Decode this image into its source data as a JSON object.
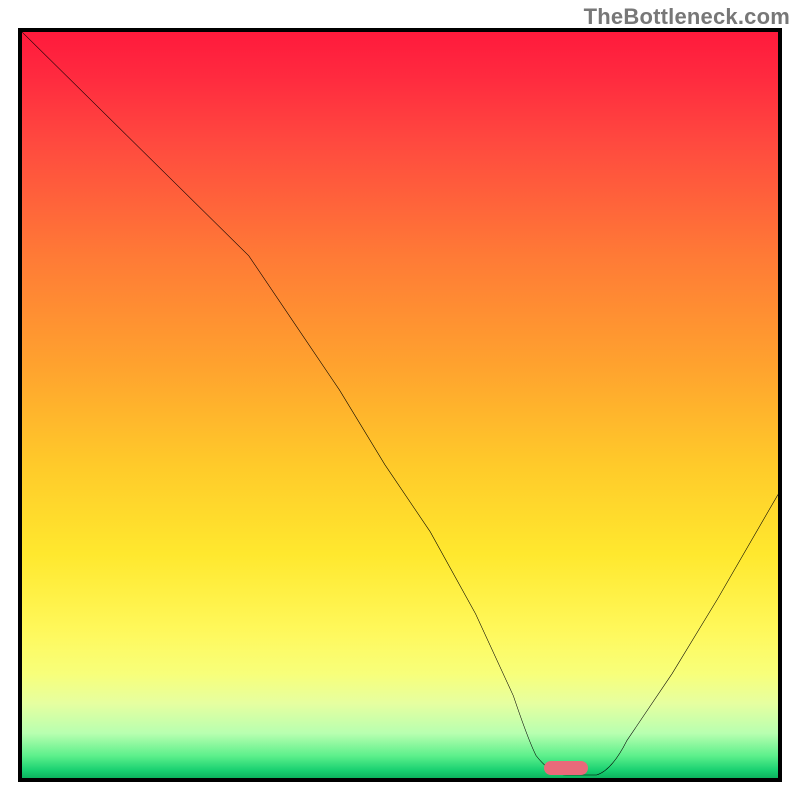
{
  "watermark_text": "TheBottleneck.com",
  "chart_data": {
    "type": "line",
    "title": "",
    "xlabel": "",
    "ylabel": "",
    "xlim": [
      0,
      100
    ],
    "ylim": [
      0,
      100
    ],
    "grid": false,
    "legend": false,
    "annotations": [
      {
        "type": "marker",
        "x": 72,
        "y": 0.5,
        "shape": "rounded-bar",
        "color": "#e96a7a"
      }
    ],
    "background_gradient": {
      "direction": "vertical",
      "stops": [
        {
          "pos": 0,
          "color": "#ff1a3c",
          "label": "red"
        },
        {
          "pos": 50,
          "color": "#ffb030",
          "label": "orange"
        },
        {
          "pos": 80,
          "color": "#fff060",
          "label": "yellow"
        },
        {
          "pos": 100,
          "color": "#10c060",
          "label": "green"
        }
      ]
    },
    "series": [
      {
        "name": "bottleneck-curve",
        "color": "#000000",
        "x": [
          0,
          7,
          14,
          20,
          26,
          30,
          36,
          42,
          48,
          54,
          60,
          65,
          68,
          72,
          76,
          80,
          86,
          92,
          100
        ],
        "y": [
          100,
          93,
          86,
          80,
          74,
          70,
          61,
          52,
          42,
          33,
          22,
          11,
          3,
          0,
          0,
          5,
          14,
          24,
          38
        ]
      }
    ],
    "optimum_x": 72
  },
  "colors": {
    "curve": "#000000",
    "border": "#000000",
    "marker": "#e96a7a",
    "watermark": "#777777"
  }
}
